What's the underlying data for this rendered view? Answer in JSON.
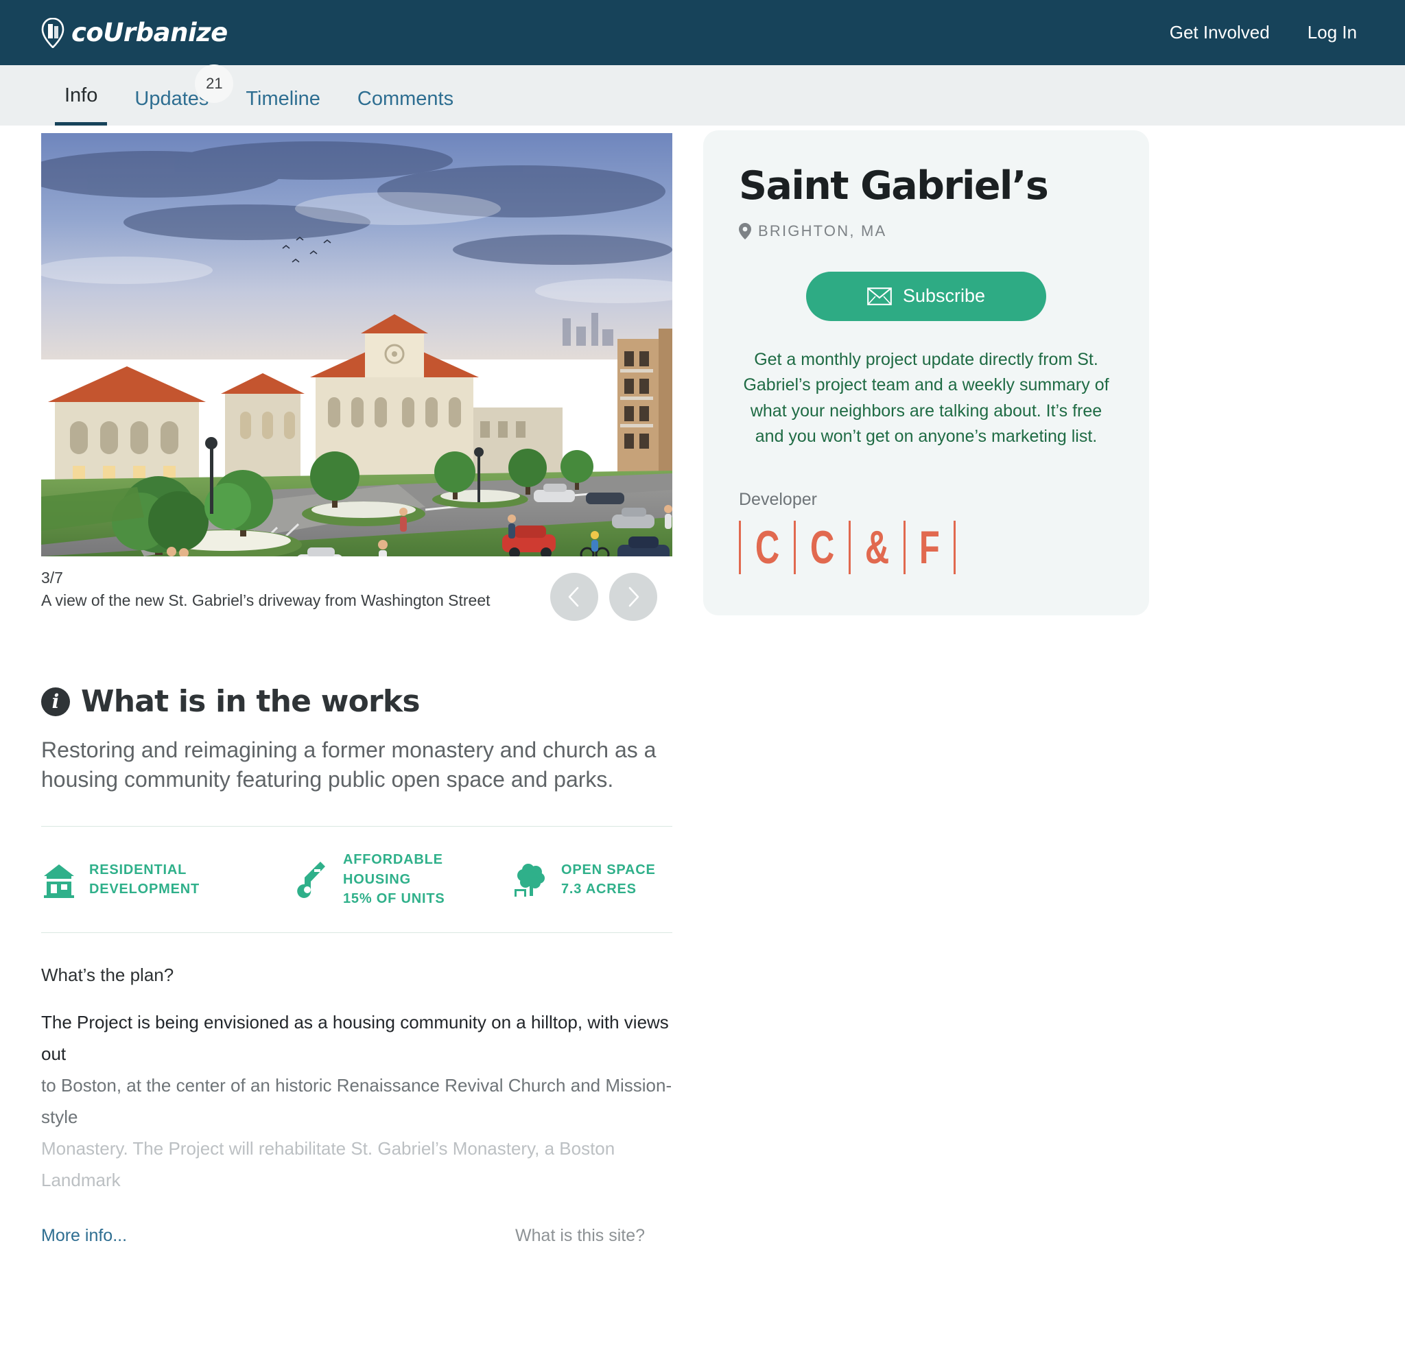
{
  "brand": {
    "name": "coUrbanize",
    "logo_icon": "location-pin-logo-icon"
  },
  "topnav": {
    "get_involved": "Get Involved",
    "log_in": "Log In"
  },
  "tabs": [
    {
      "label": "Info",
      "badge": null,
      "active": true
    },
    {
      "label": "Updates",
      "badge": "21",
      "active": false
    },
    {
      "label": "Timeline",
      "badge": null,
      "active": false
    },
    {
      "label": "Comments",
      "badge": null,
      "active": false
    }
  ],
  "carousel": {
    "count": "3/7",
    "caption": "A view of the new St. Gabriel’s driveway from Washington Street",
    "prev_icon": "chevron-left-icon",
    "next_icon": "chevron-right-icon",
    "image_alt": "Rendering of the new St. Gabriel’s driveway from Washington Street"
  },
  "works": {
    "icon": "info-circle-icon",
    "title": "What is in the works",
    "summary": "Restoring and reimagining a former monastery and church as a housing community featuring public open space and parks."
  },
  "features": [
    {
      "icon": "house-icon",
      "lines": [
        "RESIDENTIAL",
        "DEVELOPMENT"
      ]
    },
    {
      "icon": "key-icon",
      "lines": [
        "AFFORDABLE",
        "HOUSING",
        "15% OF UNITS"
      ]
    },
    {
      "icon": "tree-bench-icon",
      "lines": [
        "OPEN SPACE",
        "7.3 ACRES"
      ]
    }
  ],
  "plan": {
    "question": "What’s the plan?",
    "line1": "The Project is being envisioned as a housing community on a hilltop, with views out",
    "line2": "to Boston, at the center of an historic Renaissance Revival Church and Mission-style",
    "line3": "Monastery. The Project will rehabilitate St. Gabriel’s Monastery, a Boston Landmark"
  },
  "footer": {
    "more_info": "More info...",
    "what_is_this_site": "What is this site?"
  },
  "sidebar": {
    "title": "Saint Gabriel’s",
    "location": "BRIGHTON, MA",
    "location_icon": "map-pin-icon",
    "subscribe_label": "Subscribe",
    "subscribe_icon": "envelope-icon",
    "description": "Get a monthly project update directly from St. Gabriel’s project team and a weekly summary of what your neighbors are talking about. It’s free and you won’t get on anyone’s marketing list.",
    "developer_label": "Developer",
    "developer_logo_letters": [
      "C",
      "C",
      "&",
      "F"
    ]
  },
  "colors": {
    "navy": "#17435a",
    "tab_blue": "#2e6e91",
    "green_accent": "#2eab84",
    "feature_green": "#2fb08a",
    "desc_green": "#1f6b44",
    "developer_orange": "#e1694f",
    "card_bg": "#f2f6f6",
    "tabbar_bg": "#eceff0"
  }
}
